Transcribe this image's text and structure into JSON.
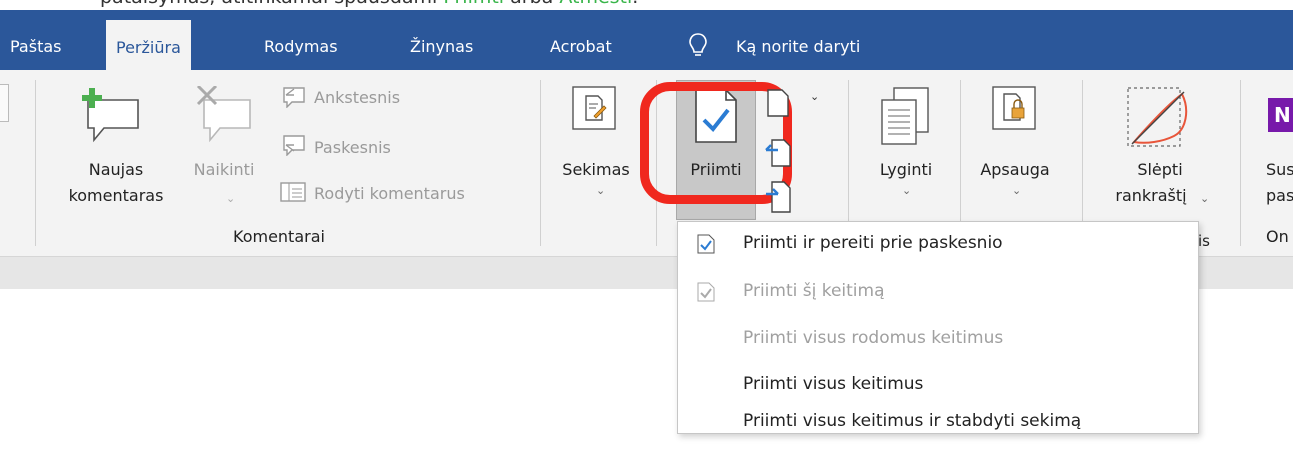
{
  "doc_top": {
    "before": "pataisymas, atitinkamai spausdami ",
    "accept": "Priimti",
    "mid": " arba ",
    "reject": "Atmesti",
    "after": "."
  },
  "tabs": [
    {
      "label": "Paštas"
    },
    {
      "label": "Peržiūra",
      "active": true
    },
    {
      "label": "Rodymas"
    },
    {
      "label": "Žinynas"
    },
    {
      "label": "Acrobat"
    }
  ],
  "tell_me": "Ką norite daryti",
  "ribbon": {
    "new_comment_1": "Naujas",
    "new_comment_2": "komentaras",
    "delete": "Naikinti",
    "previous": "Ankstesnis",
    "next": "Paskesnis",
    "show_comments": "Rodyti komentarus",
    "comments_group": "Komentarai",
    "tracking": "Sekimas",
    "accept": "Priimti",
    "compare": "Lyginti",
    "protect": "Apsauga",
    "hide_ink_1": "Slėpti",
    "hide_ink_2": "rankraštį",
    "group_fragment": "is",
    "onenote_1": "Sus",
    "onenote_2": "pas",
    "onenote_group": "On"
  },
  "accept_menu": [
    {
      "label": "Priimti ir pereiti prie paskesnio",
      "enabled": true
    },
    {
      "label": "Priimti šį keitimą",
      "enabled": false
    },
    {
      "label": "Priimti visus rodomus keitimus",
      "enabled": false
    },
    {
      "label": "Priimti visus keitimus",
      "enabled": true
    },
    {
      "label": "Priimti visus keitimus ir stabdyti sekimą",
      "enabled": true
    }
  ],
  "colors": {
    "tab_bar": "#2b579a",
    "highlight_ring": "#f0281e",
    "check_blue": "#2b7cd3",
    "onenote_purple": "#7719aa"
  }
}
